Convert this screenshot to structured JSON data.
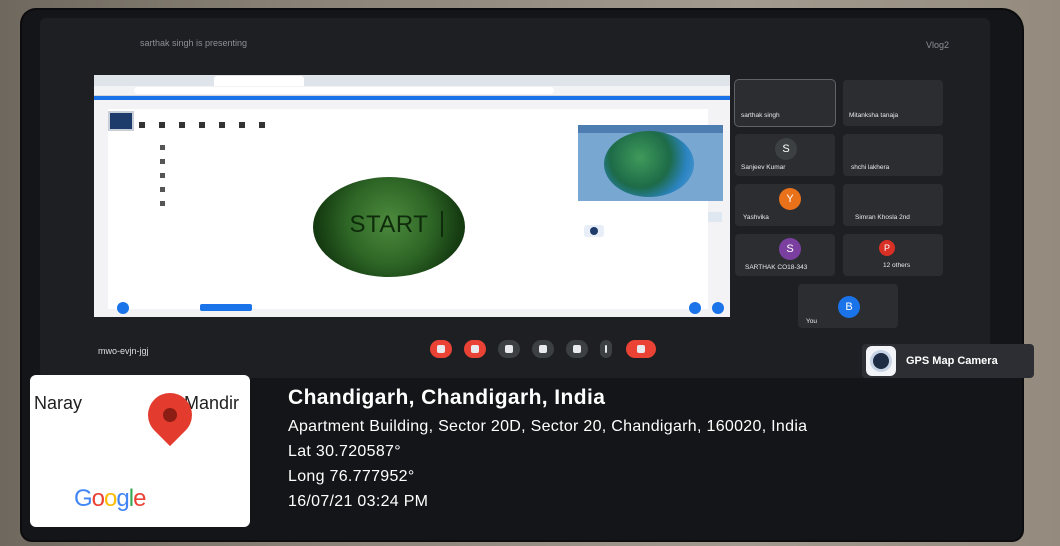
{
  "meeting": {
    "presenter_notice": "sarthak singh is presenting",
    "top_right_label": "Vlog2",
    "meeting_code": "mwo-evjn-jgj",
    "slide_text": "START",
    "participants": [
      {
        "name": "sarthak singh",
        "initial": ""
      },
      {
        "name": "Mitanksha tanaja",
        "initial": ""
      },
      {
        "name": "Sanjeev Kumar",
        "initial": "S",
        "color": "#3c4043"
      },
      {
        "name": "shchi lakhera",
        "initial": ""
      },
      {
        "name": "Yashvika",
        "initial": "Y",
        "color": "#e8711a"
      },
      {
        "name": "Simran Khosla 2nd",
        "initial": ""
      },
      {
        "name": "SARTHAK CO18-343",
        "initial": "S",
        "color": "#7b3fa0"
      },
      {
        "name": "12 others",
        "initial": "P",
        "color": "#d93025"
      },
      {
        "name": "You",
        "initial": "B",
        "color": "#1a73e8"
      }
    ]
  },
  "gps_app": {
    "label": "GPS Map Camera"
  },
  "map": {
    "poi_left": "Naray",
    "poi_right": "Mandir",
    "logo_letters": [
      "G",
      "o",
      "o",
      "g",
      "l",
      "e"
    ]
  },
  "location": {
    "city": "Chandigarh, Chandigarh, India",
    "address": "Apartment Building, Sector 20D, Sector 20, Chandigarh, 160020, India",
    "lat": "Lat 30.720587°",
    "long": "Long 76.777952°",
    "datetime": "16/07/21 03:24 PM"
  },
  "colors": {
    "accent": "#1a73e8",
    "hangup": "#ea4335",
    "pin": "#e33b2e"
  }
}
